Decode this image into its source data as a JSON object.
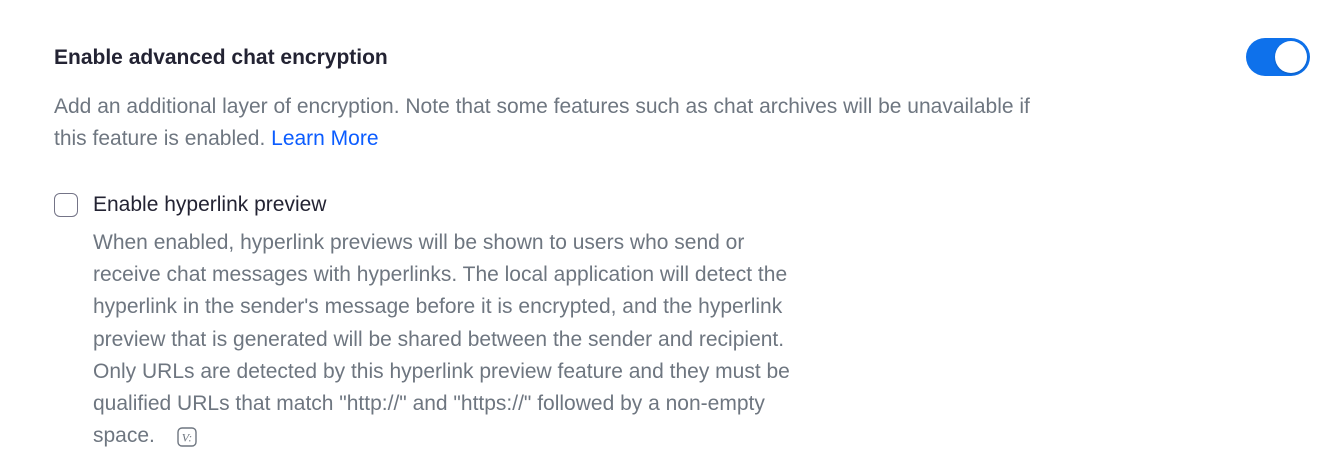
{
  "advanced_encryption": {
    "title": "Enable advanced chat encryption",
    "description": "Add an additional layer of encryption. Note that some features such as chat archives will be unavailable if this feature is enabled.",
    "learn_more": "Learn More",
    "toggle_on": true,
    "toggle_color": "#0e71eb"
  },
  "hyperlink_preview": {
    "label": "Enable hyperlink preview",
    "checked": false,
    "description_lines": [
      "When enabled, hyperlink previews will be shown to users who send or",
      "receive chat messages with hyperlinks. The local application will detect the",
      "hyperlink in the sender's message before it is encrypted, and the hyperlink",
      "preview that is generated will be shared between the sender and recipient.",
      "Only URLs are detected by this hyperlink preview feature and they must be",
      "qualified URLs that match \"http://\" and \"https://\" followed by a non-empty",
      "space."
    ],
    "trailing_icon": "v-badge-icon"
  }
}
